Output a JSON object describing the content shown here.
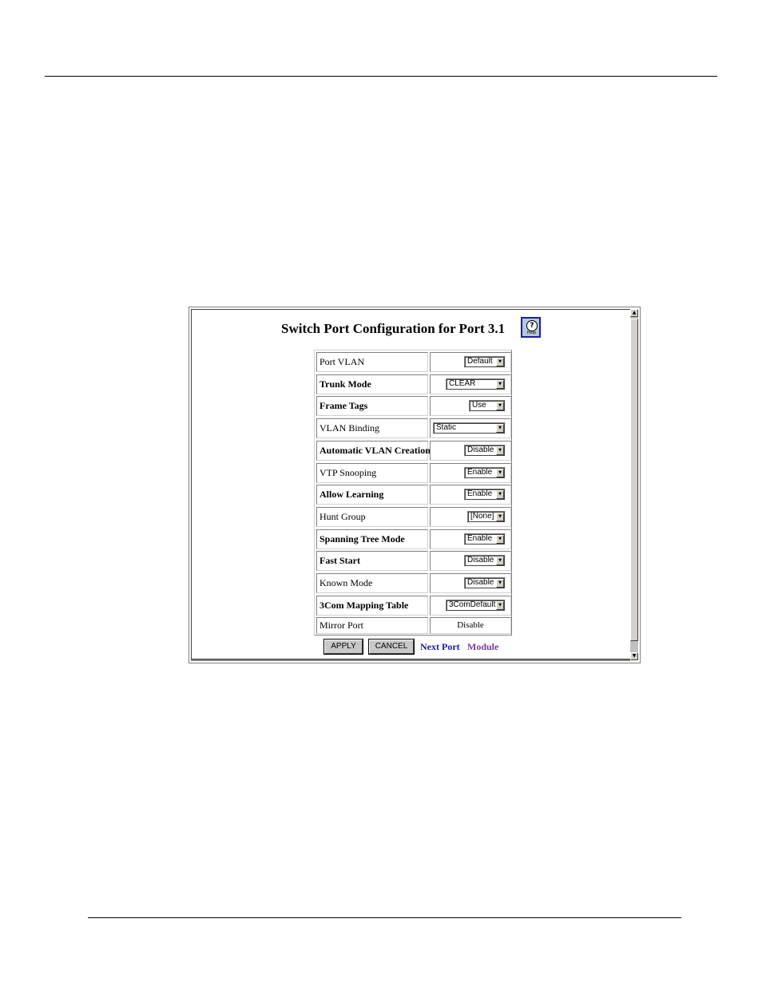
{
  "page": {
    "title": "Switch Port Configuration for Port 3.1",
    "help_label": "Help"
  },
  "rows": [
    {
      "label": "Port VLAN",
      "value": "Default"
    },
    {
      "label": "Trunk Mode",
      "value": "CLEAR"
    },
    {
      "label": "Frame Tags",
      "value": "Use"
    },
    {
      "label": "VLAN Binding",
      "value": "Static"
    },
    {
      "label": "Automatic VLAN Creation",
      "value": "Disable"
    },
    {
      "label": "VTP Snooping",
      "value": "Enable"
    },
    {
      "label": "Allow Learning",
      "value": "Enable"
    },
    {
      "label": "Hunt Group",
      "value": "[None]"
    },
    {
      "label": "Spanning Tree Mode",
      "value": "Enable"
    },
    {
      "label": "Fast Start",
      "value": "Disable"
    },
    {
      "label": "Known Mode",
      "value": "Disable"
    },
    {
      "label": "3Com Mapping Table",
      "value": "3ComDefault"
    },
    {
      "label": "Mirror Port",
      "value": "Disable"
    }
  ],
  "actions": {
    "apply_label": "APPLY",
    "cancel_label": "CANCEL",
    "next_port_label": "Next Port",
    "module_label": "Module"
  },
  "icons": {
    "help": "help-icon",
    "dropdown": "chevron-down-icon",
    "scroll_up": "arrow-up-icon",
    "scroll_down": "arrow-down-icon"
  },
  "colors": {
    "link_next": "#1a1aa6",
    "link_module": "#7a3a9a",
    "help_border": "#1b1bb0"
  }
}
